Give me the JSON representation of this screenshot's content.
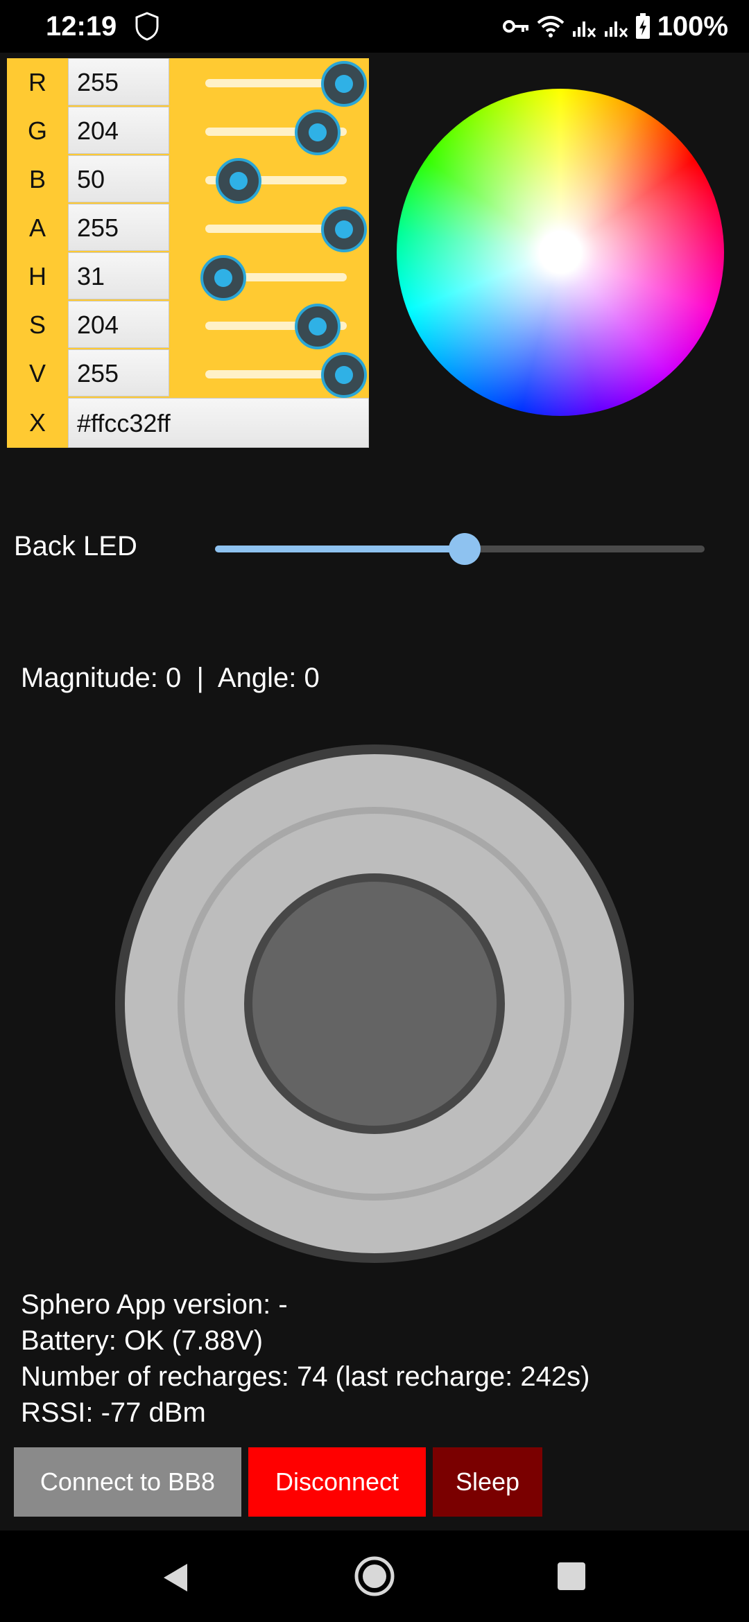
{
  "status_bar": {
    "time": "12:19",
    "battery_text": "100%",
    "icons": [
      "shield-icon",
      "key-icon",
      "wifi-icon",
      "signal-icon",
      "signal-icon",
      "battery-charging-icon"
    ]
  },
  "color_picker": {
    "rows": [
      {
        "letter": "R",
        "value": "255",
        "level": 1.0
      },
      {
        "letter": "G",
        "value": "204",
        "level": 0.8
      },
      {
        "letter": "B",
        "value": "50",
        "level": 0.2
      },
      {
        "letter": "A",
        "value": "255",
        "level": 1.0
      },
      {
        "letter": "H",
        "value": "31",
        "level": 0.086
      },
      {
        "letter": "S",
        "value": "204",
        "level": 0.8
      },
      {
        "letter": "V",
        "value": "255",
        "level": 1.0
      }
    ],
    "hex_letter": "X",
    "hex_value": "#ffcc32ff",
    "panel_color": "#ffca32"
  },
  "back_led": {
    "label": "Back LED",
    "level": 0.51
  },
  "joystick": {
    "readout": "Magnitude: 0  |  Angle: 0"
  },
  "info": {
    "app_version": "Sphero App version: -",
    "battery": "Battery: OK (7.88V)",
    "recharges": "Number of recharges: 74 (last recharge: 242s)",
    "rssi": "RSSI: -77 dBm"
  },
  "buttons": {
    "connect": "Connect to BB8",
    "disconnect": "Disconnect",
    "sleep": "Sleep"
  },
  "nav": {
    "icons": [
      "back-icon",
      "home-icon",
      "recents-icon"
    ]
  }
}
